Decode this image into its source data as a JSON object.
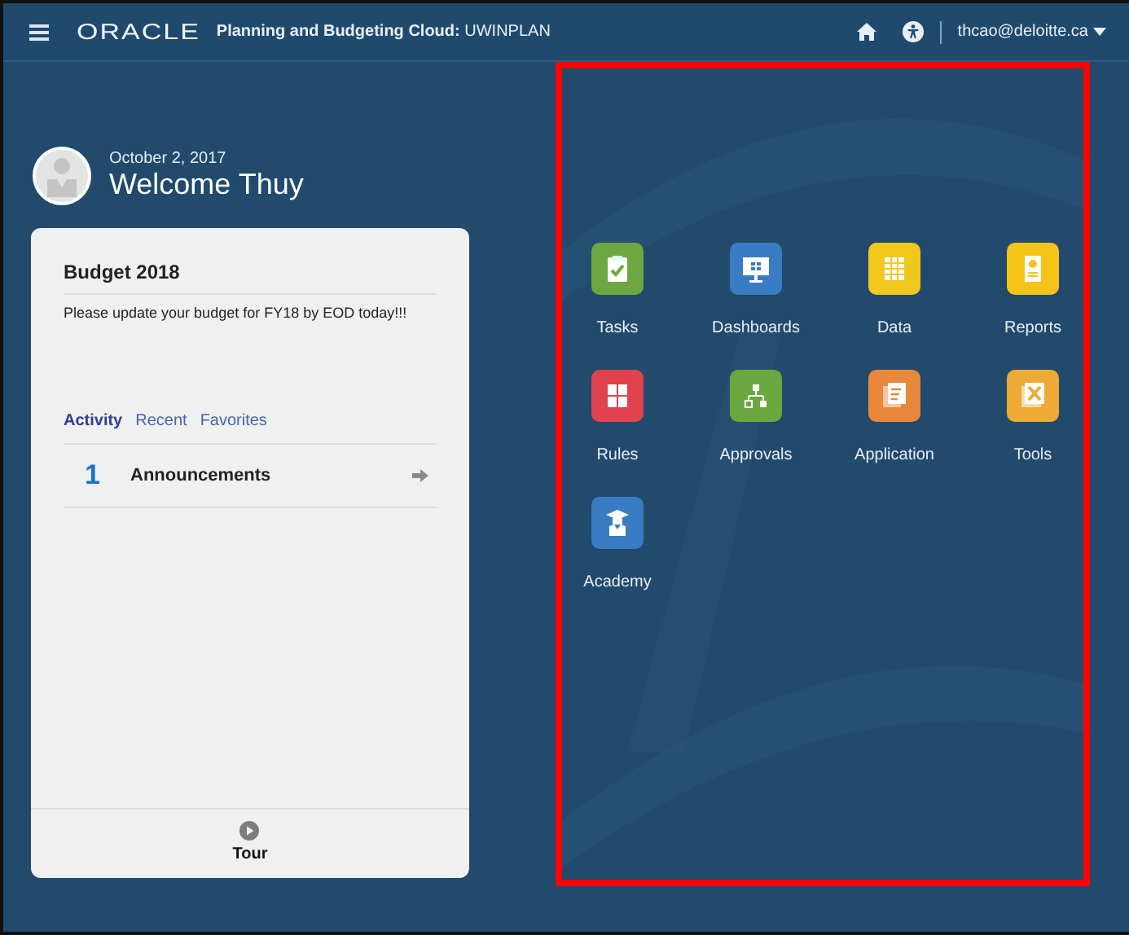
{
  "header": {
    "brand": "ORACLE",
    "title": "**Planning and Budgeting Cloud:** UWINPLAN",
    "user": "thcao@deloitte.ca"
  },
  "welcome": {
    "date": "October 2, 2017",
    "greeting": "Welcome Thuy"
  },
  "card": {
    "title": "Budget 2018",
    "message": "Please update your budget for FY18 by EOD today!!!",
    "tabs": [
      {
        "label": "Activity",
        "selected": true
      },
      {
        "label": "Recent",
        "selected": false
      },
      {
        "label": "Favorites",
        "selected": false
      }
    ],
    "items": [
      {
        "count": "1",
        "label": "Announcements"
      }
    ],
    "tour": "Tour"
  },
  "launcher": {
    "highlighted": true,
    "tiles": [
      {
        "kind": "tasks",
        "label": "Tasks",
        "color": "#6ea73f"
      },
      {
        "kind": "dashboards",
        "label": "Dashboards",
        "color": "#3a7cc3"
      },
      {
        "kind": "data",
        "label": "Data",
        "color": "#f2c81e"
      },
      {
        "kind": "reports",
        "label": "Reports",
        "color": "#f6c319"
      },
      {
        "kind": "rules",
        "label": "Rules",
        "color": "#e0434e"
      },
      {
        "kind": "approvals",
        "label": "Approvals",
        "color": "#6aa83f"
      },
      {
        "kind": "application",
        "label": "Application",
        "color": "#e8883a"
      },
      {
        "kind": "tools",
        "label": "Tools",
        "color": "#eeaa35"
      },
      {
        "kind": "academy",
        "label": "Academy",
        "color": "#3a7cc3"
      }
    ]
  }
}
